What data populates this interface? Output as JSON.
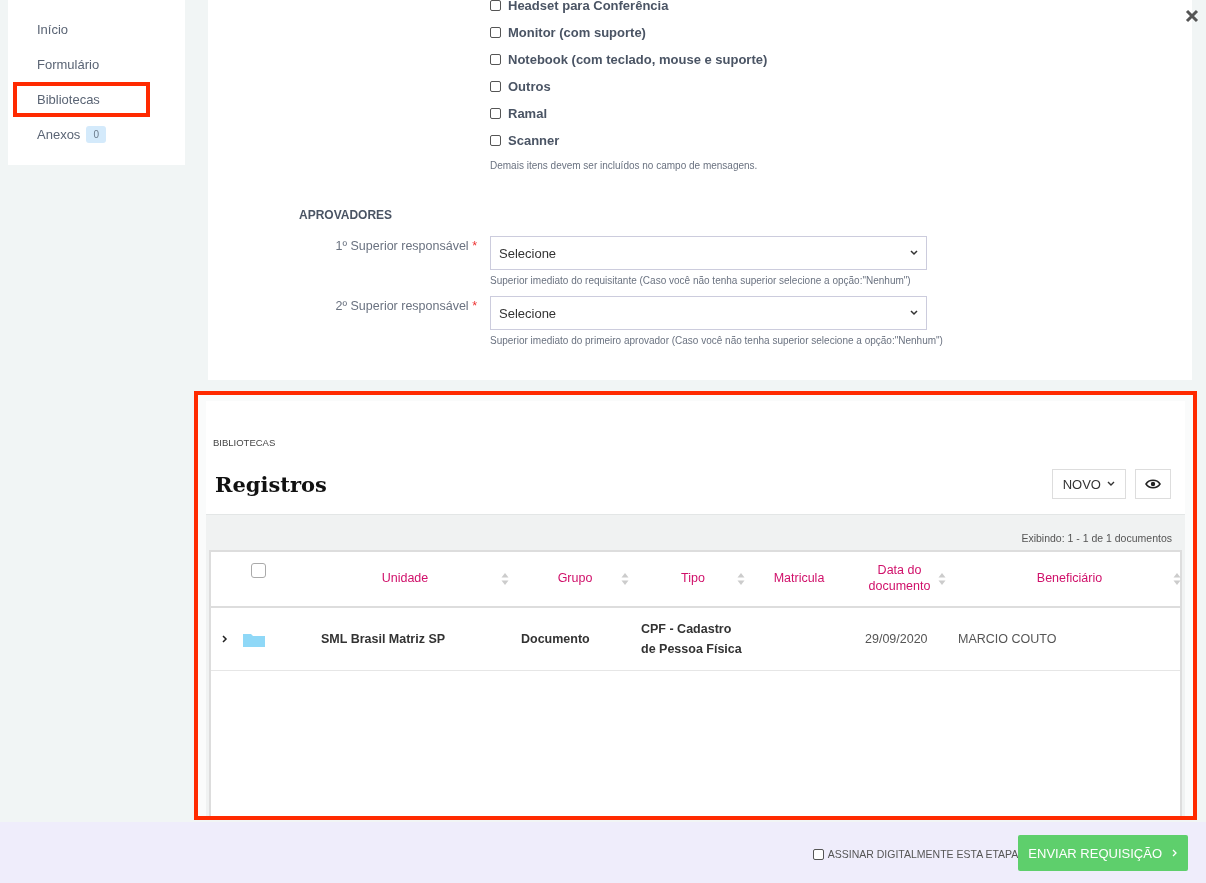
{
  "sidebar": {
    "items": [
      {
        "label": "Início",
        "selected": false
      },
      {
        "label": "Formulário",
        "selected": false
      },
      {
        "label": "Bibliotecas",
        "selected": true
      },
      {
        "label": "Anexos",
        "selected": false,
        "badge": "0"
      }
    ]
  },
  "equipment": {
    "options": [
      {
        "label": "Headset para Conferência",
        "checked": false
      },
      {
        "label": "Monitor (com suporte)",
        "checked": false
      },
      {
        "label": "Notebook (com teclado, mouse e suporte)",
        "checked": false
      },
      {
        "label": "Outros",
        "checked": false
      },
      {
        "label": "Ramal",
        "checked": false
      },
      {
        "label": "Scanner",
        "checked": false
      }
    ],
    "hint": "Demais itens devem ser incluídos no campo de mensagens."
  },
  "approvers": {
    "heading": "APROVADORES",
    "fields": [
      {
        "label": "1º Superior responsável",
        "required_mark": "*",
        "value": "Selecione",
        "hint": "Superior imediato do requisitante (Caso você não tenha superior selecione a opção:\"Nenhum\")"
      },
      {
        "label": "2º Superior responsável",
        "required_mark": "*",
        "value": "Selecione",
        "hint": "Superior imediato do primeiro aprovador (Caso você não tenha superior selecione a opção:\"Nenhum\")"
      }
    ]
  },
  "records": {
    "breadcrumb": "BIBLIOTECAS",
    "title": "Registros",
    "new_button": "NOVO",
    "count_text": "Exibindo: 1 - 1 de 1 documentos",
    "table": {
      "select_all_checked": false,
      "columns": [
        {
          "label": "Unidade",
          "sortable": true
        },
        {
          "label": "Grupo",
          "sortable": true
        },
        {
          "label": "Tipo",
          "sortable": true
        },
        {
          "label": "Matricula",
          "sortable": false
        },
        {
          "label": "Data do documento",
          "sortable": true
        },
        {
          "label": "Beneficiário",
          "sortable": true
        }
      ],
      "rows": [
        {
          "expanded": false,
          "unidade": "SML Brasil Matriz SP",
          "grupo": "Documento",
          "tipo": "CPF - Cadastro de Pessoa Física",
          "data_do_documento": "29/09/2020",
          "beneficiario": "MARCIO COUTO"
        }
      ]
    }
  },
  "footer": {
    "sign_label": "ASSINAR DIGITALMENTE ESTA ETAPA",
    "sign_checked": false,
    "submit_button": "ENVIAR REQUISIÇÃO"
  }
}
